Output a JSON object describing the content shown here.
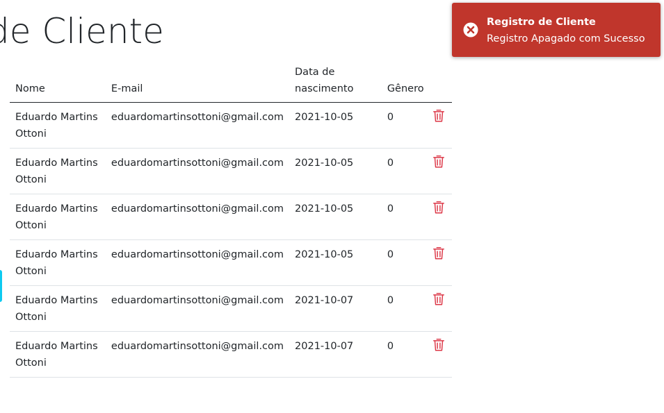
{
  "page": {
    "title": "de Cliente"
  },
  "table": {
    "headers": {
      "name": "Nome",
      "email": "E-mail",
      "birth_date": "Data de nascimento",
      "gender": "Gênero"
    },
    "rows": [
      {
        "name": "Eduardo Martins Ottoni",
        "email": "eduardomartinsottoni@gmail.com",
        "birth_date": "2021-10-05",
        "gender": "0"
      },
      {
        "name": "Eduardo Martins Ottoni",
        "email": "eduardomartinsottoni@gmail.com",
        "birth_date": "2021-10-05",
        "gender": "0"
      },
      {
        "name": "Eduardo Martins Ottoni",
        "email": "eduardomartinsottoni@gmail.com",
        "birth_date": "2021-10-05",
        "gender": "0"
      },
      {
        "name": "Eduardo Martins Ottoni",
        "email": "eduardomartinsottoni@gmail.com",
        "birth_date": "2021-10-05",
        "gender": "0"
      },
      {
        "name": "Eduardo Martins Ottoni",
        "email": "eduardomartinsottoni@gmail.com",
        "birth_date": "2021-10-07",
        "gender": "0"
      },
      {
        "name": "Eduardo Martins Ottoni",
        "email": "eduardomartinsottoni@gmail.com",
        "birth_date": "2021-10-07",
        "gender": "0"
      }
    ],
    "action_icon": "trash-icon"
  },
  "toast": {
    "title": "Registro de Cliente",
    "message": "Registro Apagado com Sucesso",
    "icon": "error-circle-icon"
  },
  "colors": {
    "toast_background": "#c0362c",
    "delete_icon": "#dc3545",
    "edge_tab": "#0dcaf0"
  }
}
